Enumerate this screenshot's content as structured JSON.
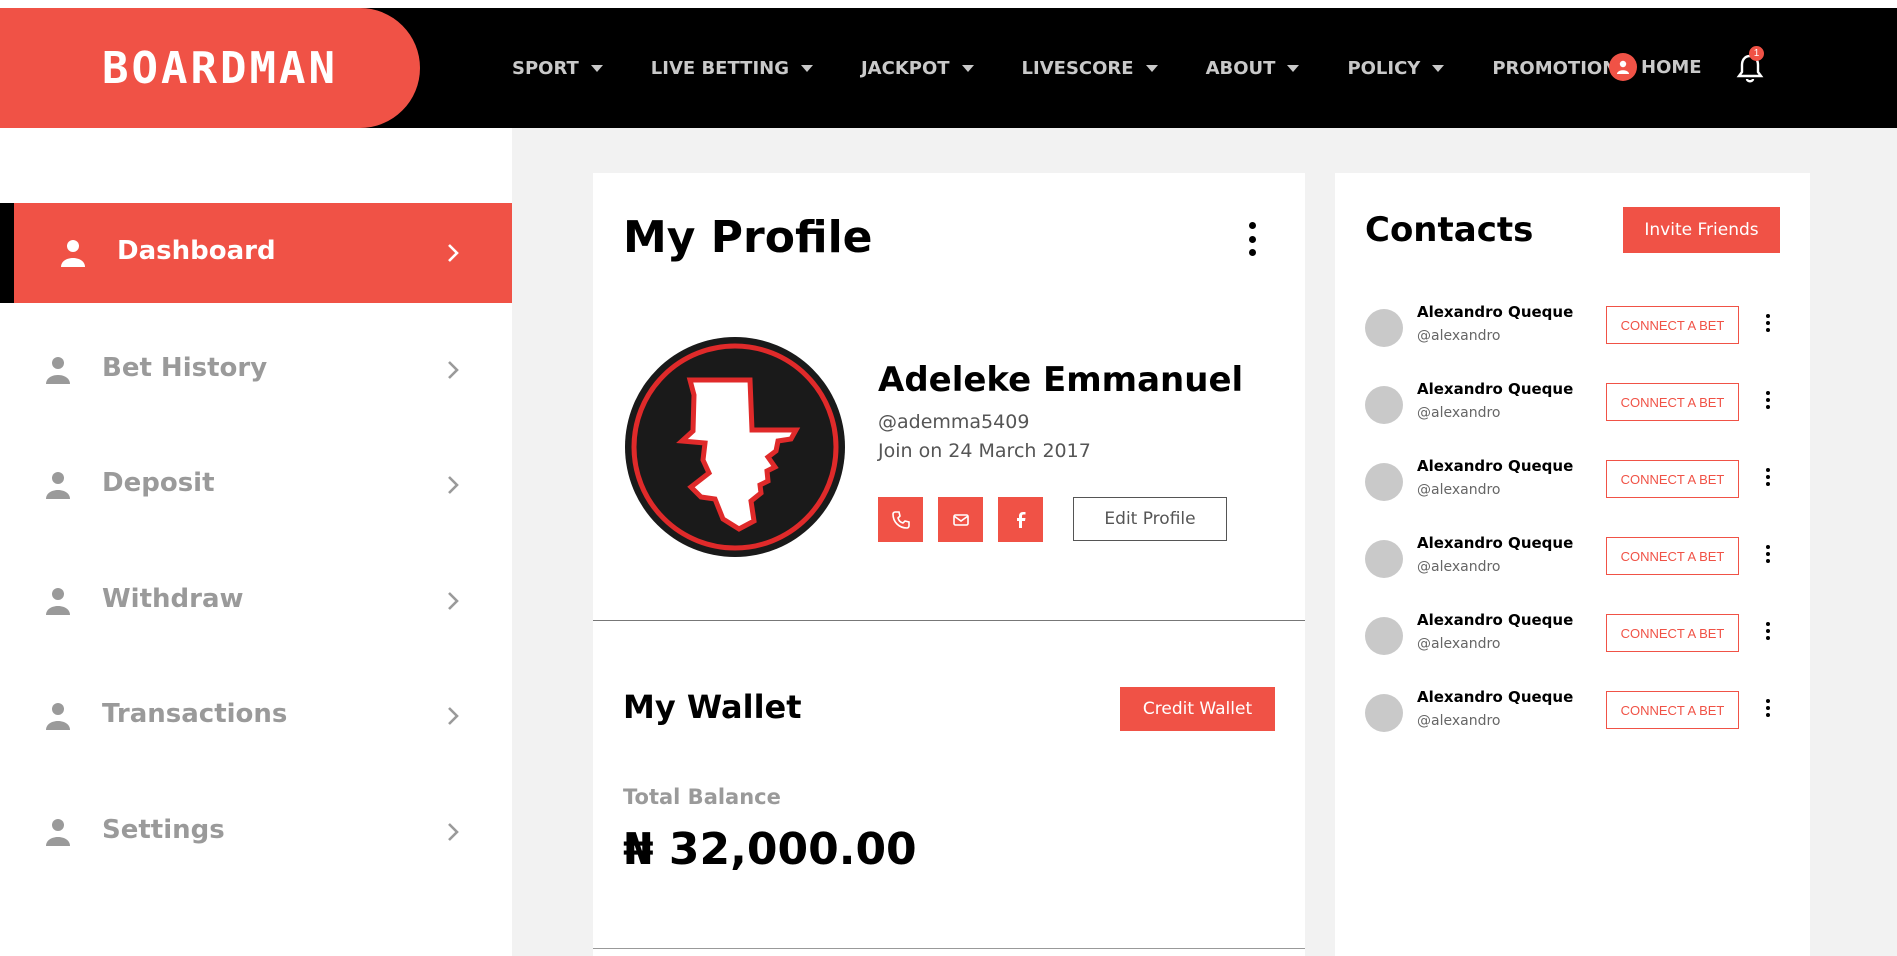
{
  "brand": {
    "logo_text": "BOARDMAN",
    "accent": "#f05246",
    "nav_bg": "#000000"
  },
  "nav": {
    "items": [
      {
        "label": "SPORT",
        "dropdown": true
      },
      {
        "label": "LIVE BETTING",
        "dropdown": true
      },
      {
        "label": "JACKPOT",
        "dropdown": true
      },
      {
        "label": "LIVESCORE",
        "dropdown": true
      },
      {
        "label": "ABOUT",
        "dropdown": true
      },
      {
        "label": "POLICY",
        "dropdown": true
      },
      {
        "label": "PROMOTION",
        "dropdown": false
      }
    ],
    "home_label": "HOME",
    "notification_count": "1"
  },
  "sidebar": {
    "items": [
      {
        "label": "Dashboard",
        "active": true,
        "icon": "user-icon"
      },
      {
        "label": "Bet History",
        "active": false,
        "icon": "user-icon"
      },
      {
        "label": "Deposit",
        "active": false,
        "icon": "user-icon"
      },
      {
        "label": "Withdraw",
        "active": false,
        "icon": "user-icon"
      },
      {
        "label": "Transactions",
        "active": false,
        "icon": "user-icon"
      },
      {
        "label": "Settings",
        "active": false,
        "icon": "user-icon"
      }
    ]
  },
  "profile": {
    "title": "My Profile",
    "name": "Adeleke Emmanuel",
    "handle": "@ademma5409",
    "joined": "Join on 24 March 2017",
    "edit_label": "Edit Profile",
    "social": [
      "phone-icon",
      "mail-icon",
      "facebook-icon"
    ]
  },
  "wallet": {
    "title": "My Wallet",
    "credit_label": "Credit Wallet",
    "total_label": "Total Balance",
    "total_value": "₦ 32,000.00"
  },
  "contacts": {
    "title": "Contacts",
    "invite_label": "Invite Friends",
    "connect_label": "CONNECT A BET",
    "list": [
      {
        "name": "Alexandro Queque",
        "handle": "@alexandro"
      },
      {
        "name": "Alexandro Queque",
        "handle": "@alexandro"
      },
      {
        "name": "Alexandro Queque",
        "handle": "@alexandro"
      },
      {
        "name": "Alexandro Queque",
        "handle": "@alexandro"
      },
      {
        "name": "Alexandro Queque",
        "handle": "@alexandro"
      },
      {
        "name": "Alexandro Queque",
        "handle": "@alexandro"
      }
    ]
  }
}
